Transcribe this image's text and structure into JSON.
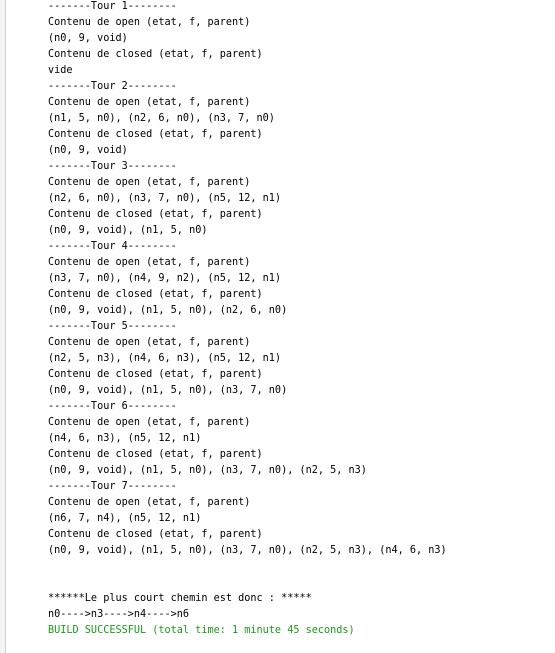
{
  "console": {
    "lines": [
      {
        "text": "-------Tour 1--------",
        "kind": "stdout"
      },
      {
        "text": "Contenu de open (etat, f, parent)",
        "kind": "stdout"
      },
      {
        "text": "(n0, 9, void)",
        "kind": "stdout"
      },
      {
        "text": "Contenu de closed (etat, f, parent)",
        "kind": "stdout"
      },
      {
        "text": "vide",
        "kind": "stdout"
      },
      {
        "text": "-------Tour 2--------",
        "kind": "stdout"
      },
      {
        "text": "Contenu de open (etat, f, parent)",
        "kind": "stdout"
      },
      {
        "text": "(n1, 5, n0), (n2, 6, n0), (n3, 7, n0)",
        "kind": "stdout"
      },
      {
        "text": "Contenu de closed (etat, f, parent)",
        "kind": "stdout"
      },
      {
        "text": "(n0, 9, void)",
        "kind": "stdout"
      },
      {
        "text": "-------Tour 3--------",
        "kind": "stdout"
      },
      {
        "text": "Contenu de open (etat, f, parent)",
        "kind": "stdout"
      },
      {
        "text": "(n2, 6, n0), (n3, 7, n0), (n5, 12, n1)",
        "kind": "stdout"
      },
      {
        "text": "Contenu de closed (etat, f, parent)",
        "kind": "stdout"
      },
      {
        "text": "(n0, 9, void), (n1, 5, n0)",
        "kind": "stdout"
      },
      {
        "text": "-------Tour 4--------",
        "kind": "stdout"
      },
      {
        "text": "Contenu de open (etat, f, parent)",
        "kind": "stdout"
      },
      {
        "text": "(n3, 7, n0), (n4, 9, n2), (n5, 12, n1)",
        "kind": "stdout"
      },
      {
        "text": "Contenu de closed (etat, f, parent)",
        "kind": "stdout"
      },
      {
        "text": "(n0, 9, void), (n1, 5, n0), (n2, 6, n0)",
        "kind": "stdout"
      },
      {
        "text": "-------Tour 5--------",
        "kind": "stdout"
      },
      {
        "text": "Contenu de open (etat, f, parent)",
        "kind": "stdout"
      },
      {
        "text": "(n2, 5, n3), (n4, 6, n3), (n5, 12, n1)",
        "kind": "stdout"
      },
      {
        "text": "Contenu de closed (etat, f, parent)",
        "kind": "stdout"
      },
      {
        "text": "(n0, 9, void), (n1, 5, n0), (n3, 7, n0)",
        "kind": "stdout"
      },
      {
        "text": "-------Tour 6--------",
        "kind": "stdout"
      },
      {
        "text": "Contenu de open (etat, f, parent)",
        "kind": "stdout"
      },
      {
        "text": "(n4, 6, n3), (n5, 12, n1)",
        "kind": "stdout"
      },
      {
        "text": "Contenu de closed (etat, f, parent)",
        "kind": "stdout"
      },
      {
        "text": "(n0, 9, void), (n1, 5, n0), (n3, 7, n0), (n2, 5, n3)",
        "kind": "stdout"
      },
      {
        "text": "-------Tour 7--------",
        "kind": "stdout"
      },
      {
        "text": "Contenu de open (etat, f, parent)",
        "kind": "stdout"
      },
      {
        "text": "(n6, 7, n4), (n5, 12, n1)",
        "kind": "stdout"
      },
      {
        "text": "Contenu de closed (etat, f, parent)",
        "kind": "stdout"
      },
      {
        "text": "(n0, 9, void), (n1, 5, n0), (n3, 7, n0), (n2, 5, n3), (n4, 6, n3)",
        "kind": "stdout"
      },
      {
        "text": "",
        "kind": "stdout"
      },
      {
        "text": "",
        "kind": "stdout"
      },
      {
        "text": "******Le plus court chemin est donc : *****",
        "kind": "stdout"
      },
      {
        "text": "n0---->n3---->n4---->n6",
        "kind": "stdout"
      },
      {
        "text": "BUILD SUCCESSFUL (total time: 1 minute 45 seconds)",
        "kind": "success"
      }
    ]
  },
  "colors": {
    "stdout": "#000000",
    "success": "#1a9a1a",
    "background": "#ffffff"
  }
}
